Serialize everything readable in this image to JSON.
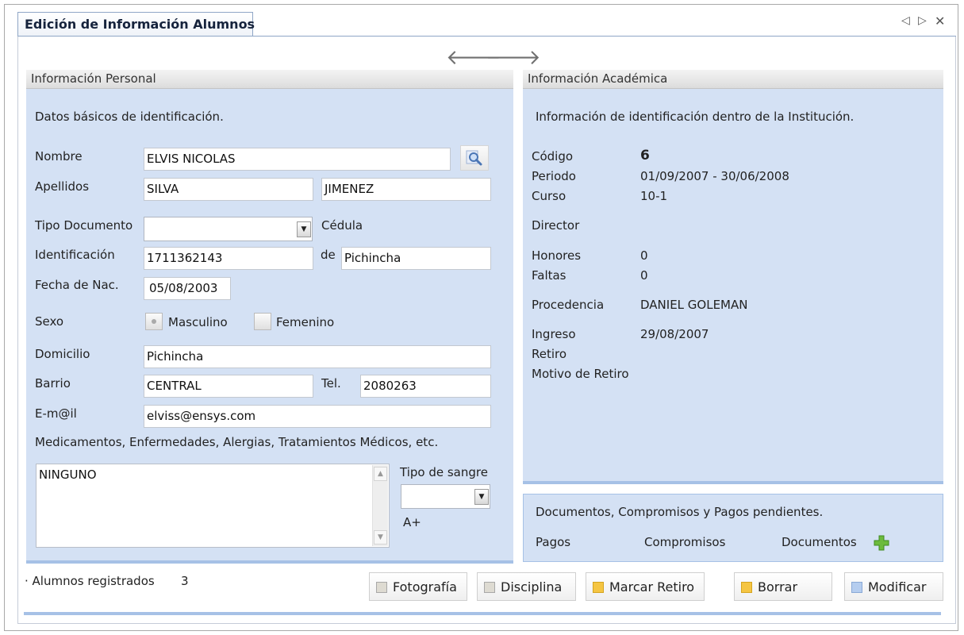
{
  "window": {
    "tab_title": "Edición de Información Alumnos",
    "controls": {
      "prev": "◁",
      "next": "▷",
      "close": "✕"
    }
  },
  "nav": {
    "back_icon": "arrow-left-icon",
    "forward_icon": "arrow-right-icon",
    "back": "🡐",
    "forward": "🡒"
  },
  "personal": {
    "header": "Información Personal",
    "subtitle": "Datos básicos de identificación.",
    "nombre_label": "Nombre",
    "nombre_value": "ELVIS NICOLAS",
    "apellidos_label": "Apellidos",
    "apellido1": "SILVA",
    "apellido2": "JIMENEZ",
    "tipo_doc_label": "Tipo Documento",
    "tipo_doc_value": "",
    "tipo_doc_desc": "Cédula",
    "identificacion_label": "Identificación",
    "identificacion_value": "1711362143",
    "de_label": "de",
    "de_value": "Pichincha",
    "fecha_label": "Fecha de Nac.",
    "fecha_value": "05/08/2003",
    "sexo_label": "Sexo",
    "masculino": "Masculino",
    "femenino": "Femenino",
    "sexo_selected": "Masculino",
    "domicilio_label": "Domicilio",
    "domicilio_value": "Pichincha",
    "barrio_label": "Barrio",
    "barrio_value": "CENTRAL",
    "tel_label": "Tel.",
    "tel_value": "2080263",
    "email_label": "E-m@il",
    "email_value": "elviss@ensys.com",
    "medical_label": "Medicamentos, Enfermedades, Alergias, Tratamientos Médicos, etc.",
    "medical_value": "NINGUNO",
    "sangre_label": "Tipo de sangre",
    "sangre_value": "A+"
  },
  "academic": {
    "header": "Información Académica",
    "subtitle": "Información de identificación dentro de la Institución.",
    "codigo_label": "Código",
    "codigo_value": "6",
    "periodo_label": "Periodo",
    "periodo_value": "01/09/2007 - 30/06/2008",
    "curso_label": "Curso",
    "curso_value": "10-1",
    "director_label": "Director",
    "honores_label": "Honores",
    "honores_value": "0",
    "faltas_label": "Faltas",
    "faltas_value": "0",
    "procedencia_label": "Procedencia",
    "procedencia_value": "DANIEL GOLEMAN",
    "ingreso_label": "Ingreso",
    "ingreso_value": "29/08/2007",
    "retiro_label": "Retiro",
    "motivo_label": "Motivo de Retiro"
  },
  "pending": {
    "title": "Documentos, Compromisos y Pagos pendientes.",
    "pagos": "Pagos",
    "compromisos": "Compromisos",
    "documentos": "Documentos",
    "add_icon": "plus-icon"
  },
  "footer": {
    "registered_label": "Alumnos registrados",
    "registered_count": "3",
    "buttons": {
      "fotografia": "Fotografía",
      "disciplina": "Disciplina",
      "marcar_retiro": "Marcar Retiro",
      "borrar": "Borrar",
      "modificar": "Modificar"
    }
  },
  "colors": {
    "panel_bg": "#d4e1f4",
    "accent_blue": "#a6c1e6",
    "yellow": "#f5c542",
    "gray": "#dedbd2",
    "light_blue": "#b5cdef",
    "plus_green": "#6cbb3c"
  }
}
